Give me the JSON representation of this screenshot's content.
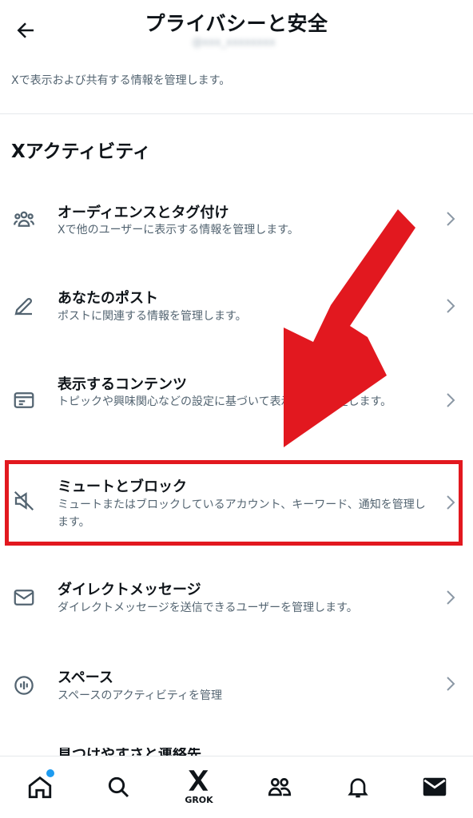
{
  "header": {
    "title": "プライバシーと安全",
    "handle": "@xxx_xxxxxxxx",
    "description": "Xで表示および共有する情報を管理します。"
  },
  "section": {
    "title": "Xアクティビティ"
  },
  "items": [
    {
      "label": "オーディエンスとタグ付け",
      "sub": "Xで他のユーザーに表示する情報を管理します。",
      "icon": "people-icon"
    },
    {
      "label": "あなたのポスト",
      "sub": "ポストに関連する情報を管理します。",
      "icon": "pencil-icon"
    },
    {
      "label": "表示するコンテンツ",
      "sub": "トピックや興味関心などの設定に基づいて表示内容を決定します。",
      "icon": "content-icon"
    },
    {
      "label": "ミュートとブロック",
      "sub": "ミュートまたはブロックしているアカウント、キーワード、通知を管理します。",
      "icon": "mute-icon"
    },
    {
      "label": "ダイレクトメッセージ",
      "sub": "ダイレクトメッセージを送信できるユーザーを管理します。",
      "icon": "envelope-icon"
    },
    {
      "label": "スペース",
      "sub": "スペースのアクティビティを管理",
      "icon": "spaces-icon"
    }
  ],
  "partial_item": {
    "label": "見つけやすさと連絡先"
  },
  "bottom_nav": {
    "grok_label": "GROK"
  },
  "colors": {
    "annotation_red": "#e2181f",
    "accent": "#1d9bf0"
  }
}
